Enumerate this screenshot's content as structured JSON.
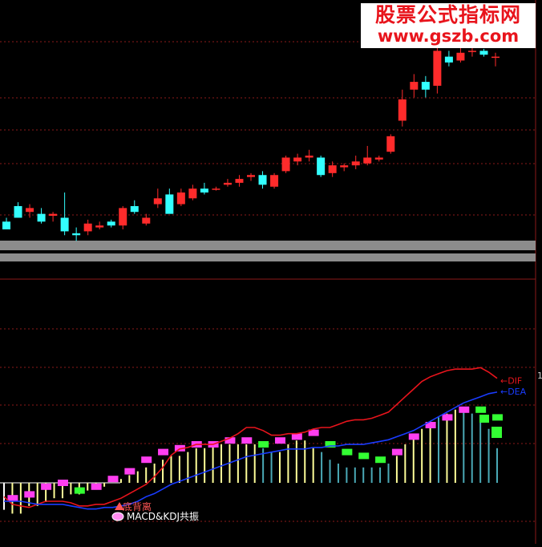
{
  "watermark": {
    "line1": "股票公式指标网",
    "line2": "www.gszb.com"
  },
  "colors": {
    "up": "#ff2b2b",
    "down": "#33ffff",
    "grid": "#8b1a1a",
    "band": "#8c8c8c",
    "dif": "#e8141c",
    "dea": "#1a3cff",
    "hist_pos": "#ffff99",
    "hist_neg": "#ffffff",
    "hist_teal": "#4aa9b6",
    "kdj_up": "#ff3ef0",
    "kdj_down": "#33ff33",
    "annotation": "#ff5555"
  },
  "chart_data": [
    {
      "type": "candlestick",
      "grid": true,
      "ylim": [
        0,
        100
      ],
      "candles": [
        {
          "o": 4,
          "h": 6,
          "l": 0,
          "c": 0
        },
        {
          "o": 12,
          "h": 14,
          "l": 6,
          "c": 6
        },
        {
          "o": 9,
          "h": 13,
          "l": 6,
          "c": 11
        },
        {
          "o": 8,
          "h": 11,
          "l": 3,
          "c": 4
        },
        {
          "o": 7,
          "h": 9,
          "l": 4,
          "c": 8
        },
        {
          "o": 6,
          "h": 19,
          "l": -3,
          "c": -1
        },
        {
          "o": -2,
          "h": 1,
          "l": -6,
          "c": -3
        },
        {
          "o": -1,
          "h": 5,
          "l": -3,
          "c": 3
        },
        {
          "o": 1,
          "h": 4,
          "l": 0,
          "c": 2
        },
        {
          "o": 4,
          "h": 5,
          "l": 1,
          "c": 2
        },
        {
          "o": 2,
          "h": 12,
          "l": 0,
          "c": 11
        },
        {
          "o": 12,
          "h": 15,
          "l": 8,
          "c": 9
        },
        {
          "o": 3,
          "h": 8,
          "l": 2,
          "c": 6
        },
        {
          "o": 13,
          "h": 21,
          "l": 11,
          "c": 16
        },
        {
          "o": 18,
          "h": 21,
          "l": 9,
          "c": 8
        },
        {
          "o": 13,
          "h": 21,
          "l": 12,
          "c": 19
        },
        {
          "o": 16,
          "h": 23,
          "l": 15,
          "c": 21
        },
        {
          "o": 21,
          "h": 24,
          "l": 18,
          "c": 19
        },
        {
          "o": 21,
          "h": 22,
          "l": 20,
          "c": 21
        },
        {
          "o": 23,
          "h": 26,
          "l": 22,
          "c": 24
        },
        {
          "o": 24,
          "h": 28,
          "l": 22,
          "c": 26
        },
        {
          "o": 27,
          "h": 29,
          "l": 25,
          "c": 28
        },
        {
          "o": 28,
          "h": 30,
          "l": 21,
          "c": 23
        },
        {
          "o": 22,
          "h": 29,
          "l": 21,
          "c": 28
        },
        {
          "o": 30,
          "h": 38,
          "l": 29,
          "c": 37
        },
        {
          "o": 35,
          "h": 39,
          "l": 33,
          "c": 37
        },
        {
          "o": 37,
          "h": 41,
          "l": 35,
          "c": 38
        },
        {
          "o": 37,
          "h": 38,
          "l": 27,
          "c": 28
        },
        {
          "o": 29,
          "h": 35,
          "l": 27,
          "c": 33
        },
        {
          "o": 32,
          "h": 34,
          "l": 30,
          "c": 33
        },
        {
          "o": 33,
          "h": 38,
          "l": 31,
          "c": 35
        },
        {
          "o": 34,
          "h": 43,
          "l": 33,
          "c": 37
        },
        {
          "o": 36,
          "h": 38,
          "l": 35,
          "c": 37
        },
        {
          "o": 40,
          "h": 49,
          "l": 39,
          "c": 48
        },
        {
          "o": 56,
          "h": 72,
          "l": 53,
          "c": 67
        },
        {
          "o": 72,
          "h": 80,
          "l": 68,
          "c": 76
        },
        {
          "o": 76,
          "h": 79,
          "l": 68,
          "c": 72
        },
        {
          "o": 74,
          "h": 94,
          "l": 70,
          "c": 92
        },
        {
          "o": 89,
          "h": 92,
          "l": 84,
          "c": 86
        },
        {
          "o": 87,
          "h": 96,
          "l": 86,
          "c": 91
        },
        {
          "o": 92,
          "h": 96,
          "l": 89,
          "c": 92
        },
        {
          "o": 92,
          "h": 93,
          "l": 89,
          "c": 90
        },
        {
          "o": 89,
          "h": 91,
          "l": 84,
          "c": 89
        }
      ]
    },
    {
      "type": "line",
      "ylim": [
        -20,
        100
      ],
      "series": [
        {
          "name": "DIF",
          "values": [
            -5,
            -10,
            -11,
            -12,
            -10,
            -8,
            -8,
            -8,
            -9,
            -11,
            -11,
            -10,
            -10,
            -8,
            -6,
            -3,
            0,
            3,
            8,
            14,
            22,
            26,
            27,
            29,
            29,
            29,
            31,
            33,
            36,
            40,
            40,
            38,
            35,
            35,
            36,
            36,
            37,
            39,
            40,
            40,
            42,
            44,
            45,
            45,
            46,
            48,
            50,
            55,
            60,
            65,
            70,
            73,
            75,
            77,
            78,
            78,
            78,
            79,
            76,
            72
          ]
        },
        {
          "name": "DEA",
          "values": [
            -8,
            -8,
            -8,
            -9,
            -10,
            -10,
            -10,
            -10,
            -11,
            -12,
            -13,
            -13,
            -12,
            -12,
            -11,
            -10,
            -8,
            -5,
            -3,
            0,
            3,
            5,
            7,
            9,
            11,
            13,
            15,
            17,
            19,
            21,
            22,
            23,
            24,
            25,
            26,
            26,
            26,
            27,
            27,
            28,
            28,
            29,
            29,
            29,
            30,
            31,
            32,
            34,
            36,
            38,
            41,
            44,
            47,
            50,
            53,
            56,
            58,
            60,
            62,
            63
          ]
        }
      ],
      "histogram": [
        {
          "v": -7,
          "c": "hist_neg"
        },
        {
          "v": -8,
          "c": "hist_pos"
        },
        {
          "v": -8,
          "c": "hist_pos"
        },
        {
          "v": -6,
          "c": "hist_pos"
        },
        {
          "v": -6,
          "c": "hist_pos"
        },
        {
          "v": -5,
          "c": "hist_pos"
        },
        {
          "v": -4,
          "c": "hist_pos"
        },
        {
          "v": -4,
          "c": "hist_pos"
        },
        {
          "v": -3,
          "c": "hist_pos"
        },
        {
          "v": -3,
          "c": "hist_pos"
        },
        {
          "v": -2,
          "c": "hist_pos"
        },
        {
          "v": -1,
          "c": "hist_pos"
        },
        {
          "v": -1,
          "c": "hist_pos"
        },
        {
          "v": 0,
          "c": "hist_pos"
        },
        {
          "v": 1,
          "c": "hist_pos"
        },
        {
          "v": 2,
          "c": "hist_pos"
        },
        {
          "v": 3,
          "c": "hist_pos"
        },
        {
          "v": 4,
          "c": "hist_pos"
        },
        {
          "v": 5,
          "c": "hist_pos"
        },
        {
          "v": 6,
          "c": "hist_pos"
        },
        {
          "v": 7,
          "c": "hist_pos"
        },
        {
          "v": 7,
          "c": "hist_pos"
        },
        {
          "v": 8,
          "c": "hist_pos"
        },
        {
          "v": 9,
          "c": "hist_pos"
        },
        {
          "v": 9,
          "c": "hist_pos"
        },
        {
          "v": 10,
          "c": "hist_pos"
        },
        {
          "v": 10,
          "c": "hist_pos"
        },
        {
          "v": 10,
          "c": "hist_pos"
        },
        {
          "v": 10,
          "c": "hist_pos"
        },
        {
          "v": 10,
          "c": "hist_pos"
        },
        {
          "v": 10,
          "c": "hist_pos"
        },
        {
          "v": 9,
          "c": "hist_teal"
        },
        {
          "v": 8,
          "c": "hist_teal"
        },
        {
          "v": 8,
          "c": "hist_pos"
        },
        {
          "v": 10,
          "c": "hist_pos"
        },
        {
          "v": 11,
          "c": "hist_pos"
        },
        {
          "v": 11,
          "c": "hist_pos"
        },
        {
          "v": 9,
          "c": "hist_pos"
        },
        {
          "v": 8,
          "c": "hist_teal"
        },
        {
          "v": 6,
          "c": "hist_teal"
        },
        {
          "v": 5,
          "c": "hist_teal"
        },
        {
          "v": 4,
          "c": "hist_teal"
        },
        {
          "v": 4,
          "c": "hist_teal"
        },
        {
          "v": 4,
          "c": "hist_teal"
        },
        {
          "v": 4,
          "c": "hist_teal"
        },
        {
          "v": 4,
          "c": "hist_teal"
        },
        {
          "v": 5,
          "c": "hist_teal"
        },
        {
          "v": 7,
          "c": "hist_pos"
        },
        {
          "v": 10,
          "c": "hist_pos"
        },
        {
          "v": 12,
          "c": "hist_pos"
        },
        {
          "v": 14,
          "c": "hist_pos"
        },
        {
          "v": 16,
          "c": "hist_pos"
        },
        {
          "v": 17,
          "c": "hist_teal"
        },
        {
          "v": 18,
          "c": "hist_pos"
        },
        {
          "v": 19,
          "c": "hist_pos"
        },
        {
          "v": 19,
          "c": "hist_teal"
        },
        {
          "v": 18,
          "c": "hist_teal"
        },
        {
          "v": 16,
          "c": "hist_teal"
        },
        {
          "v": 14,
          "c": "hist_teal"
        },
        {
          "v": 9,
          "c": "hist_teal"
        }
      ],
      "kdj_marks": [
        {
          "i": 1,
          "v": -4,
          "c": "kdj_up"
        },
        {
          "i": 3,
          "v": -3,
          "c": "kdj_up"
        },
        {
          "i": 5,
          "v": -1,
          "c": "kdj_up"
        },
        {
          "i": 7,
          "v": 0,
          "c": "kdj_up"
        },
        {
          "i": 9,
          "v": -2,
          "c": "kdj_down"
        },
        {
          "i": 11,
          "v": -1,
          "c": "kdj_up"
        },
        {
          "i": 13,
          "v": 1,
          "c": "kdj_up"
        },
        {
          "i": 15,
          "v": 3,
          "c": "kdj_up"
        },
        {
          "i": 17,
          "v": 6,
          "c": "kdj_up"
        },
        {
          "i": 19,
          "v": 8,
          "c": "kdj_up"
        },
        {
          "i": 21,
          "v": 9,
          "c": "kdj_up"
        },
        {
          "i": 23,
          "v": 10,
          "c": "kdj_up"
        },
        {
          "i": 25,
          "v": 10,
          "c": "kdj_up"
        },
        {
          "i": 27,
          "v": 11,
          "c": "kdj_up"
        },
        {
          "i": 29,
          "v": 11,
          "c": "kdj_up"
        },
        {
          "i": 31,
          "v": 10,
          "c": "kdj_down"
        },
        {
          "i": 33,
          "v": 11,
          "c": "kdj_up"
        },
        {
          "i": 35,
          "v": 12,
          "c": "kdj_up"
        },
        {
          "i": 37,
          "v": 13,
          "c": "kdj_up"
        },
        {
          "i": 39,
          "v": 10,
          "c": "kdj_down"
        },
        {
          "i": 41,
          "v": 8,
          "c": "kdj_down"
        },
        {
          "i": 43,
          "v": 7,
          "c": "kdj_down"
        },
        {
          "i": 45,
          "v": 6,
          "c": "kdj_down"
        },
        {
          "i": 47,
          "v": 8,
          "c": "kdj_up"
        },
        {
          "i": 49,
          "v": 12,
          "c": "kdj_up"
        },
        {
          "i": 51,
          "v": 15,
          "c": "kdj_up"
        },
        {
          "i": 53,
          "v": 17,
          "c": "kdj_up"
        },
        {
          "i": 55,
          "v": 19,
          "c": "kdj_up"
        },
        {
          "i": 57,
          "v": 19,
          "c": "kdj_down"
        },
        {
          "i": 59,
          "v": 17,
          "c": "kdj_down"
        }
      ],
      "annotations": {
        "divergence": "底背离",
        "resonance": "MACD&KDJ共振"
      },
      "legend_labels": {
        "dif": "DIF",
        "dea": "DEA"
      },
      "right_edge_label": "1"
    }
  ]
}
